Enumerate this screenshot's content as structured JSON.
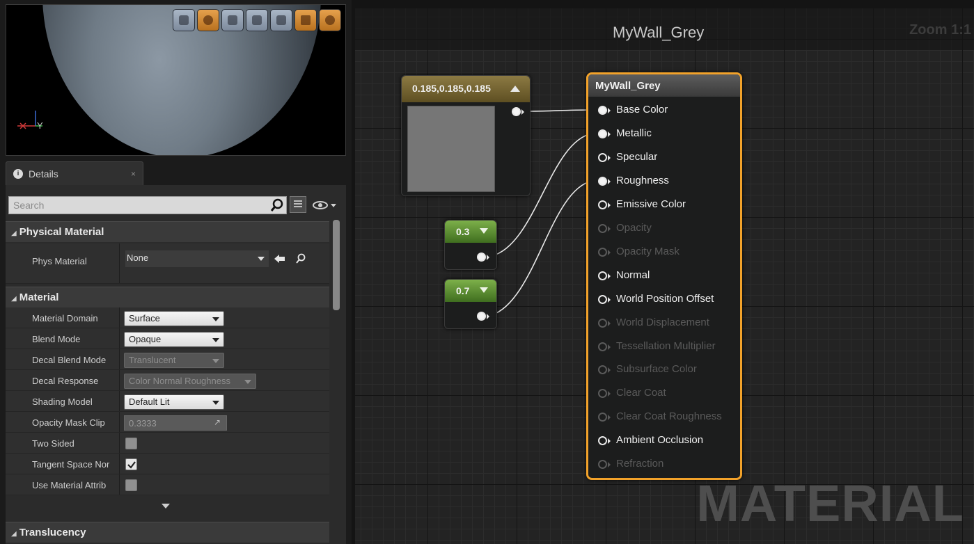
{
  "details_tab": {
    "label": "Details",
    "close": "×",
    "info_glyph": "i"
  },
  "search": {
    "placeholder": "Search"
  },
  "categories": {
    "physical_material": "Physical Material",
    "material": "Material",
    "translucency": "Translucency"
  },
  "phys_material": {
    "label": "Phys Material",
    "value": "None"
  },
  "properties": [
    {
      "label": "Material Domain",
      "value": "Surface"
    },
    {
      "label": "Blend Mode",
      "value": "Opaque"
    },
    {
      "label": "Decal Blend Mode",
      "value": "Translucent"
    },
    {
      "label": "Decal Response",
      "value": "Color Normal Roughness"
    },
    {
      "label": "Shading Model",
      "value": "Default Lit"
    },
    {
      "label": "Opacity Mask Clip",
      "value": "0.3333"
    },
    {
      "label": "Two Sided",
      "checked": false
    },
    {
      "label": "Tangent Space Nor",
      "checked": true
    },
    {
      "label": "Use Material Attrib",
      "checked": false
    }
  ],
  "viewport": {
    "axis_label": "Y"
  },
  "graph": {
    "title": "MyWall_Grey",
    "zoom": "Zoom 1:1",
    "watermark": "MATERIAL"
  },
  "color_node": {
    "value": "0.185,0.185,0.185",
    "swatch_color": "#767676"
  },
  "const_nodes": [
    {
      "value": "0.3"
    },
    {
      "value": "0.7"
    }
  ],
  "main_node": {
    "title": "MyWall_Grey",
    "inputs": [
      "Base Color",
      "Metallic",
      "Specular",
      "Roughness",
      "Emissive Color",
      "Opacity",
      "Opacity Mask",
      "Normal",
      "World Position Offset",
      "World Displacement",
      "Tessellation Multiplier",
      "Subsurface Color",
      "Clear Coat",
      "Clear Coat Roughness",
      "Ambient Occlusion",
      "Refraction"
    ],
    "input_states": [
      "connected",
      "connected",
      "enabled",
      "connected",
      "enabled",
      "disabled",
      "disabled",
      "enabled",
      "enabled",
      "disabled",
      "disabled",
      "disabled",
      "disabled",
      "disabled",
      "enabled",
      "disabled"
    ]
  },
  "colors": {
    "accent": "#f2a22a",
    "const_header": "#5e9a35",
    "color_header": "#7a6a36"
  }
}
